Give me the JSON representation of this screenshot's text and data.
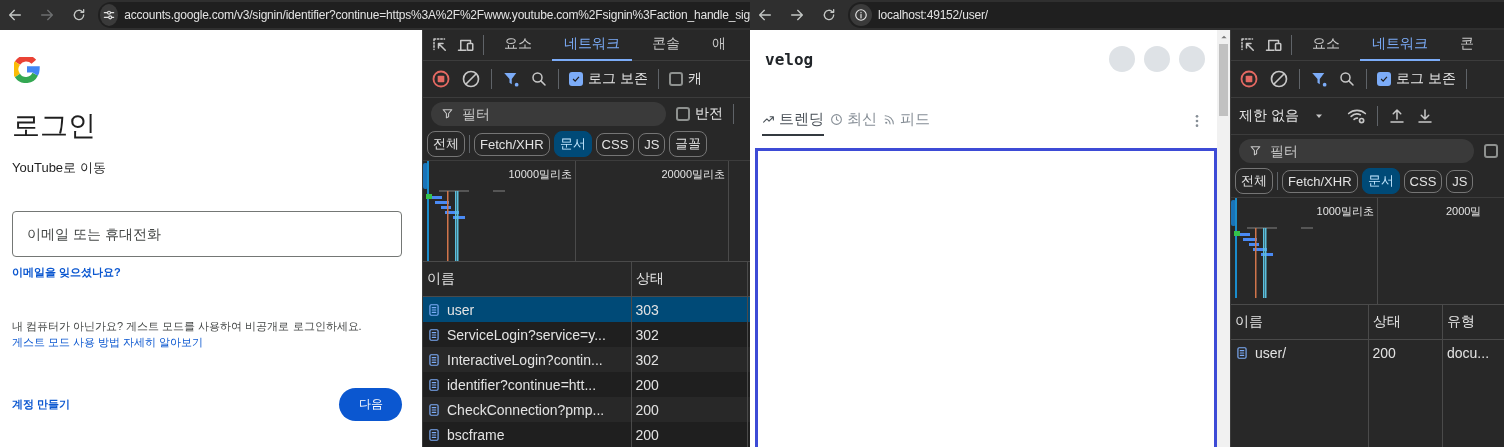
{
  "windows": [
    {
      "kind": "google_signin",
      "address_bar": {
        "url": "accounts.google.com/v3/signin/identifier?continue=https%3A%2F%2Fwww.youtube.com%2Fsignin%3Faction_handle_sig",
        "forward_enabled": false
      },
      "page": {
        "title": "로그인",
        "subtitle": "YouTube로 이동",
        "email_field": {
          "placeholder": "이메일 또는 휴대전화"
        },
        "forgot_link": "이메일을 잊으셨나요?",
        "guest_notice": {
          "text": "내 컴퓨터가 아닌가요? 게스트 모드를 사용하여 비공개로 로그인하세요. ",
          "link": "게스트 모드 사용 방법 자세히 알아보기"
        },
        "create_account": "계정 만들기",
        "next_button": "다음"
      },
      "devtools": {
        "panel_tabs": [
          {
            "label": "요소",
            "selected": false
          },
          {
            "label": "네트워크",
            "selected": true
          },
          {
            "label": "콘솔",
            "selected": false
          },
          {
            "label": "애",
            "selected": false
          }
        ],
        "recording": true,
        "preserve_log": {
          "label": "로그 보존",
          "checked": true
        },
        "disable_cache": {
          "label": "캐",
          "checked": false
        },
        "filter": {
          "placeholder": "필터"
        },
        "invert": {
          "label": "반전",
          "checked": false
        },
        "type_filters": [
          {
            "label": "전체",
            "selected": false
          },
          {
            "label": "Fetch/XHR",
            "selected": false
          },
          {
            "label": "문서",
            "selected": true
          },
          {
            "label": "CSS",
            "selected": false
          },
          {
            "label": "JS",
            "selected": false
          },
          {
            "label": "글꼴",
            "selected": false
          }
        ],
        "timeline": {
          "ticks": [
            "10000밀리초",
            "20000밀리초"
          ]
        },
        "table": {
          "columns": [
            "이름",
            "상태"
          ],
          "rows": [
            {
              "name": "user",
              "status": "303",
              "selected": true
            },
            {
              "name": "ServiceLogin?service=y...",
              "status": "302",
              "selected": false
            },
            {
              "name": "InteractiveLogin?contin...",
              "status": "302",
              "selected": false
            },
            {
              "name": "identifier?continue=htt...",
              "status": "200",
              "selected": false
            },
            {
              "name": "CheckConnection?pmp...",
              "status": "200",
              "selected": false
            },
            {
              "name": "bscframe",
              "status": "200",
              "selected": false
            }
          ]
        }
      }
    },
    {
      "kind": "velog",
      "address_bar": {
        "url": "localhost:49152/user/",
        "forward_enabled": true
      },
      "page": {
        "logo": "velog",
        "tabs": [
          {
            "label": "트렌딩",
            "selected": true
          },
          {
            "label": "최신",
            "selected": false
          },
          {
            "label": "피드",
            "selected": false
          }
        ]
      },
      "devtools": {
        "panel_tabs": [
          {
            "label": "요소",
            "selected": false
          },
          {
            "label": "네트워크",
            "selected": true
          },
          {
            "label": "콘",
            "selected": false
          }
        ],
        "recording": true,
        "preserve_log": {
          "label": "로그 보존",
          "checked": true
        },
        "throttle": "제한 없음",
        "filter": {
          "placeholder": "필터"
        },
        "invert": {
          "checked": false
        },
        "type_filters": [
          {
            "label": "전체",
            "selected": false
          },
          {
            "label": "Fetch/XHR",
            "selected": false
          },
          {
            "label": "문서",
            "selected": true
          },
          {
            "label": "CSS",
            "selected": false
          },
          {
            "label": "JS",
            "selected": false
          }
        ],
        "timeline": {
          "ticks": [
            "1000밀리초",
            "2000밀"
          ]
        },
        "table": {
          "columns": [
            "이름",
            "상태",
            "유형"
          ],
          "rows": [
            {
              "name": "user/",
              "status": "200",
              "type": "docu...",
              "selected": false
            }
          ]
        }
      }
    }
  ]
}
